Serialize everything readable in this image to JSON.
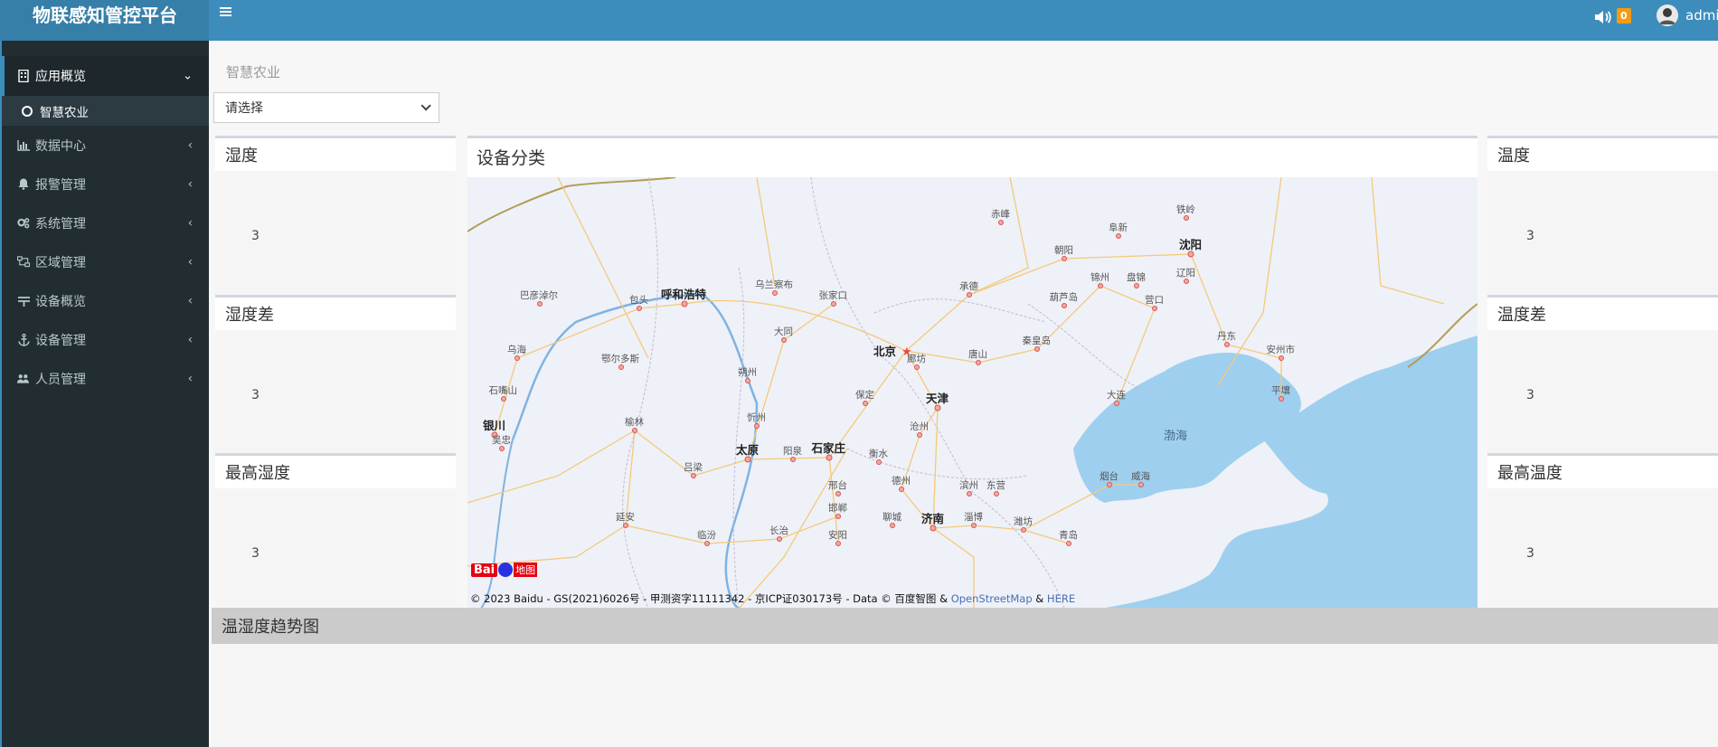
{
  "header": {
    "logo": "物联感知管控平台",
    "notification_count": "0",
    "username": "admin"
  },
  "sidebar": {
    "items": [
      {
        "label": "应用概览",
        "icon": "building-icon",
        "active": true
      },
      {
        "label": "数据中心",
        "icon": "bar-chart-icon"
      },
      {
        "label": "报警管理",
        "icon": "bell-icon"
      },
      {
        "label": "系统管理",
        "icon": "cogs-icon"
      },
      {
        "label": "区域管理",
        "icon": "sitemap-icon"
      },
      {
        "label": "设备概览",
        "icon": "sliders-icon"
      },
      {
        "label": "设备管理",
        "icon": "anchor-icon"
      },
      {
        "label": "人员管理",
        "icon": "users-icon"
      }
    ],
    "submenu_label": "智慧农业"
  },
  "main": {
    "breadcrumb": "智慧农业",
    "select_value": "请选择",
    "left_cards": [
      {
        "title": "湿度",
        "value": "3"
      },
      {
        "title": "湿度差",
        "value": "3"
      },
      {
        "title": "最高湿度",
        "value": "3"
      }
    ],
    "right_cards": [
      {
        "title": "温度",
        "value": "3"
      },
      {
        "title": "温度差",
        "value": "3"
      },
      {
        "title": "最高温度",
        "value": "3"
      }
    ],
    "map_title": "设备分类",
    "trend_title": "温湿度趋势图"
  },
  "map": {
    "copyright_prefix": "© 2023 Baidu - GS(2021)6026号 - 甲测资字11111342 - 京ICP证030173号 - Data © 百度智图 &",
    "osm": "OpenStreetMap",
    "amp": "&",
    "here": "HERE",
    "logo_text": "Bai",
    "logo_cn": "地图",
    "sea_label": "渤海",
    "cities": [
      {
        "name": "北京",
        "major": true
      },
      {
        "name": "天津",
        "major": true
      },
      {
        "name": "石家庄",
        "major": true
      },
      {
        "name": "太原",
        "major": true
      },
      {
        "name": "济南",
        "major": true
      },
      {
        "name": "沈阳",
        "major": true
      },
      {
        "name": "呼和浩特",
        "major": true
      },
      {
        "name": "银川",
        "major": true
      },
      {
        "name": "赤峰"
      },
      {
        "name": "阜新"
      },
      {
        "name": "铁岭"
      },
      {
        "name": "朝阳"
      },
      {
        "name": "锦州"
      },
      {
        "name": "盘锦"
      },
      {
        "name": "辽阳"
      },
      {
        "name": "葫芦岛"
      },
      {
        "name": "营口"
      },
      {
        "name": "承德"
      },
      {
        "name": "张家口"
      },
      {
        "name": "乌兰察布"
      },
      {
        "name": "包头"
      },
      {
        "name": "巴彦淖尔"
      },
      {
        "name": "乌海"
      },
      {
        "name": "鄂尔多斯"
      },
      {
        "name": "大同"
      },
      {
        "name": "朔州"
      },
      {
        "name": "忻州"
      },
      {
        "name": "阳泉"
      },
      {
        "name": "保定"
      },
      {
        "name": "廊坊"
      },
      {
        "name": "唐山"
      },
      {
        "name": "秦皇岛"
      },
      {
        "name": "沧州"
      },
      {
        "name": "衡水"
      },
      {
        "name": "德州"
      },
      {
        "name": "滨州"
      },
      {
        "name": "东营"
      },
      {
        "name": "淄博"
      },
      {
        "name": "潍坊"
      },
      {
        "name": "烟台"
      },
      {
        "name": "威海"
      },
      {
        "name": "大连"
      },
      {
        "name": "丹东"
      },
      {
        "name": "安州市"
      },
      {
        "name": "平壤"
      },
      {
        "name": "吕梁"
      },
      {
        "name": "榆林"
      },
      {
        "name": "石嘴山"
      },
      {
        "name": "吴忠"
      },
      {
        "name": "延安"
      },
      {
        "name": "临汾"
      },
      {
        "name": "长治"
      },
      {
        "name": "邢台"
      },
      {
        "name": "邯郸"
      },
      {
        "name": "安阳"
      },
      {
        "name": "聊城"
      },
      {
        "name": "青岛"
      }
    ]
  }
}
